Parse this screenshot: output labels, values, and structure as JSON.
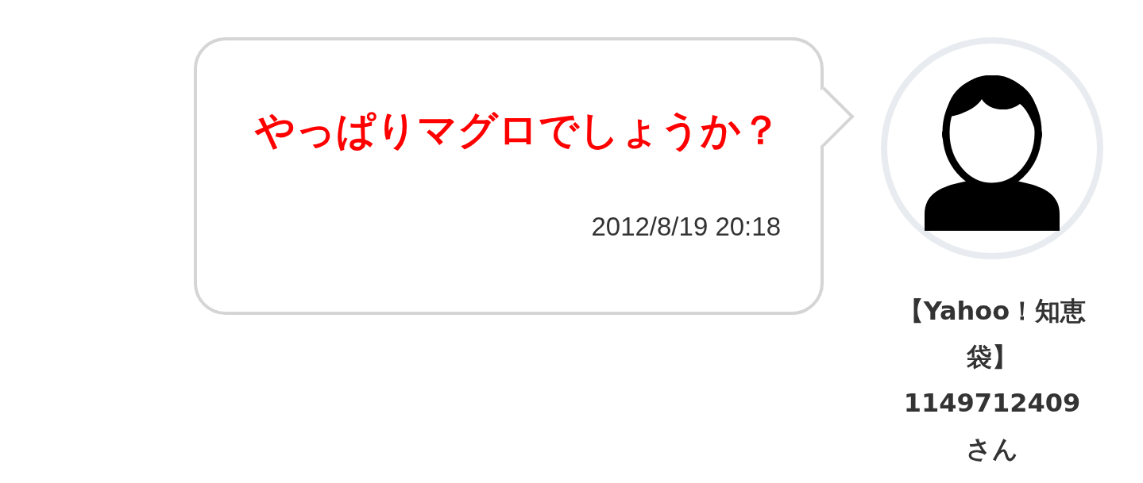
{
  "message": {
    "text": "やっぱりマグロでしょうか？",
    "timestamp": "2012/8/19 20:18"
  },
  "author": {
    "name": "【Yahoo！知恵袋】1149712409さん"
  }
}
